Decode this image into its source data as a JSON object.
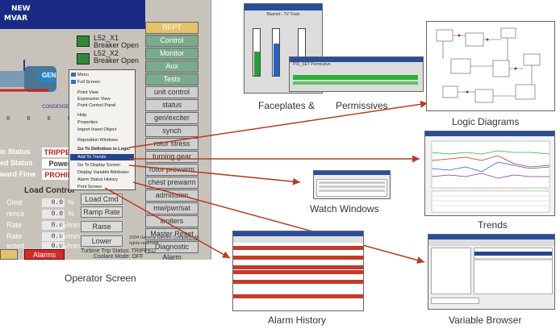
{
  "operator_screen": {
    "title_lines": [
      "NEW",
      "MVAR"
    ],
    "right_buttons": [
      "RFPT",
      "Control",
      "Monitor",
      "Aux",
      "Tests",
      "unit control",
      "status",
      "gen/exciter",
      "synch",
      "rotor stress",
      "turning gear",
      "rotor prewarm",
      "chest prewarm",
      "admission mode",
      "mw/pwr/sat",
      "limiters",
      "Master Reset",
      "Diagnostic Alarm"
    ],
    "breaker1": "L52_X1 Breaker Open",
    "breaker2": "L52_X2 Breaker Open",
    "condensed_label": "CONDENSER",
    "gen_label": "GEN",
    "status_rows": [
      {
        "label": "ic Status",
        "value": "TRIPPED"
      },
      {
        "label": "ed Status",
        "value": "Power"
      },
      {
        "label": "ward Flow",
        "value": "PROHIBI"
      }
    ],
    "load_control_title": "Load Control",
    "lc_rows": [
      {
        "label": "Cmd",
        "value": "0.0",
        "unit": "%"
      },
      {
        "label": "rence",
        "value": "0.0",
        "unit": "%"
      },
      {
        "label": "Rate",
        "value": "0.0",
        "unit": "%/min"
      },
      {
        "label": "Rate",
        "value": "0.0",
        "unit": "%/min"
      },
      {
        "label": "ected",
        "value": "0.0",
        "unit": "%/min"
      }
    ],
    "side_buttons": [
      "Load Cmd",
      "Ramp Rate",
      "Raise",
      "Lower"
    ],
    "copyright": "2004 General Electric Company. All rights reserved.",
    "alarms_btn": "Alarms",
    "trip_status": "Turbine Trip Status: TRIPPED",
    "coolant_mode": "Coolant Mode: OFF",
    "small_vals": [
      "0",
      "0",
      "0",
      "0"
    ]
  },
  "context_menu": {
    "items": [
      "Menu",
      "Full Screen",
      "Point View",
      "Expression View",
      "Point Control Panel",
      "Help",
      "Properties",
      "Import Insert Object",
      "Reposition Windows",
      "Go To Definition in Logic",
      "Add To Trends",
      "Go To Display Screen",
      "Display Variable Attributes",
      "Alarm Status History",
      "Print Screen"
    ],
    "highlighted": "Add To Trends"
  },
  "labels": {
    "operator": "Operator Screen",
    "faceplates": "Faceplates &",
    "permissives": "Permissives",
    "logic": "Logic Diagrams",
    "watch": "Watch Windows",
    "trends": "Trends",
    "alarm": "Alarm History",
    "variable": "Variable Browser"
  },
  "faceplate_title": "Bluenet - TV Track",
  "permissive_title": "PID_SET Permissive",
  "colors": {
    "brand_blue": "#1a2b86",
    "green_btn": "#7aab8c",
    "trip_red": "#d12a2a",
    "arrow_red": "#b83b1f"
  }
}
